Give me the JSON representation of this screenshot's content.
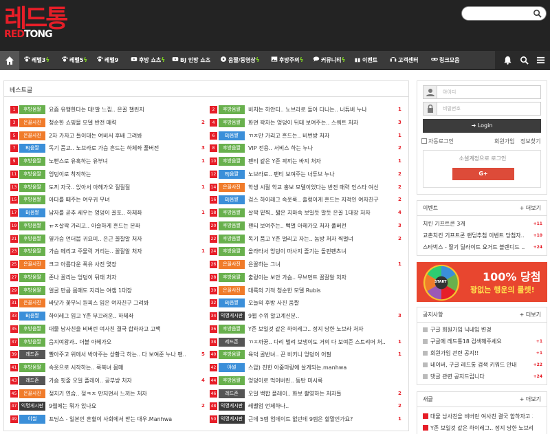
{
  "logo": {
    "ko": "레드통",
    "en_red": "RED",
    "en_white": "TONG"
  },
  "nav": {
    "items": [
      {
        "label": "레벨3",
        "icon": "paw-icon",
        "bolt": true
      },
      {
        "label": "레벨5",
        "icon": "paw-icon",
        "bolt": true
      },
      {
        "label": "레벨9",
        "icon": "paw-icon",
        "bolt": false
      },
      {
        "label": "후방 쇼츠",
        "icon": "youtube-icon",
        "bolt": true
      },
      {
        "label": "BJ 인방 쇼츠",
        "icon": "youtube-icon",
        "bolt": false
      },
      {
        "label": "움짤/동영상",
        "icon": "play-icon",
        "bolt": true
      },
      {
        "label": "후방주의",
        "icon": "image-icon",
        "bolt": true
      },
      {
        "label": "커뮤니티",
        "icon": "chat-icon",
        "bolt": true
      },
      {
        "label": "이벤트",
        "icon": "gift-icon",
        "bolt": false
      },
      {
        "label": "고객센터",
        "icon": "headset-icon",
        "bolt": false
      },
      {
        "label": "링크모음",
        "icon": "link-icon",
        "bolt": false
      }
    ]
  },
  "best": {
    "title": "베스트글",
    "badge_colors": {
      "후방움짤": "#68b04d",
      "은꼴사진": "#f07b2a",
      "BJ움짤": "#3b8fd9",
      "레드존": "#555555",
      "익명게시판": "#3a3a3a",
      "야썰": "#3b8fd9"
    },
    "left": [
      {
        "n": "1",
        "b": "후방움짤",
        "t": "요즘 유행한다는 대!발 느낌.. 은꼴 챌린지",
        "c": ""
      },
      {
        "n": "3",
        "b": "은꼴사진",
        "t": "청순한 쇼핑몰 모델 반전 매력",
        "c": "2"
      },
      {
        "n": "5",
        "b": "은꼴사진",
        "t": "2차 가자고 들이대는 여비서 후배 그려봐",
        "c": ""
      },
      {
        "n": "7",
        "b": "BJ움짤",
        "t": "독기 품고.. 노브라로 가슴 흔드는 하체좌 풀버전",
        "c": "3"
      },
      {
        "n": "9",
        "b": "후방움짤",
        "t": "노빤스로 유혹하는 유부녀",
        "c": "1"
      },
      {
        "n": "11",
        "b": "후방움짤",
        "t": "엉덩이로 착작하는",
        "c": ""
      },
      {
        "n": "13",
        "b": "후방움짤",
        "t": "도끼 자국.. 앉아서 아헤가오 질질질",
        "c": "1"
      },
      {
        "n": "15",
        "b": "후방움짤",
        "t": "아다를 떼주는 여우귀 무녀",
        "c": ""
      },
      {
        "n": "17",
        "b": "BJ움짤",
        "t": "남자를 곧추 세우는 엉덩이 꼴포.. 하체좌",
        "c": "1"
      },
      {
        "n": "19",
        "b": "후방움짤",
        "t": "ㅠㅈ살짝 가리고.. 아슬하게 흔드는 본좌",
        "c": ""
      },
      {
        "n": "21",
        "b": "후방움짤",
        "t": "옆가슴 언더붑 귀요미.. 은근 꼴잘알 처자",
        "c": ""
      },
      {
        "n": "23",
        "b": "후방움짤",
        "t": "가슴 떼리고 주물럭 거리는.. 꼴잘알 처자",
        "c": "1"
      },
      {
        "n": "25",
        "b": "은꼴사진",
        "t": "크고 아름다운 폭유 사진 몇장",
        "c": ""
      },
      {
        "n": "27",
        "b": "후방움짤",
        "t": "존나 꼴리는 엉덩이 뒤태 처자",
        "c": ""
      },
      {
        "n": "29",
        "b": "후방움짤",
        "t": "얼굴 만큼 몸매도 지리는 여캠 1대장",
        "c": ""
      },
      {
        "n": "31",
        "b": "은꼴사진",
        "t": "바닷가 꽃무늬 원피스 입은 여자친구 그려봐",
        "c": ""
      },
      {
        "n": "33",
        "b": "BJ움짤",
        "t": "하이레그 입고 Y존 부끄러운.. 하체좌",
        "c": ""
      },
      {
        "n": "35",
        "b": "후방움짤",
        "t": "대물 남사친을 비버린 여사친 결국 합하자고 고백",
        "c": ""
      },
      {
        "n": "37",
        "b": "후방움짤",
        "t": "음지여왕과.. 더블 아헤가오",
        "c": ""
      },
      {
        "n": "39",
        "b": "레드존",
        "t": "빨아주고 위에서 박아주는 상황극 하는.. 다 보여준 누나 팬..",
        "c": "5"
      },
      {
        "n": "41",
        "b": "후방움짤",
        "t": "속옷으로 시작하는.. 룩북녀 몸매",
        "c": ""
      },
      {
        "n": "43",
        "b": "레드존",
        "t": "가슴 핏줄 오일 플레이.. 공부방 처자",
        "c": "4"
      },
      {
        "n": "45",
        "b": "은꼴사진",
        "t": "젖치기 연습.. 젖ㅋㅈ 만지면서 느끼는 처자",
        "c": ""
      },
      {
        "n": "47",
        "b": "익명게시판",
        "t": "9웹에는 뭐가 있나요",
        "c": "2"
      },
      {
        "n": "49",
        "b": "야썰",
        "t": "프딩스 - 일본인 혼혈이 사회에서 받는 대우.Manhwa",
        "c": ""
      }
    ],
    "right": [
      {
        "n": "2",
        "b": "후방움짤",
        "t": "비치는 하얀티.. 노브라로 돌아 다니는.. 너튜버 누나",
        "c": "1"
      },
      {
        "n": "4",
        "b": "후방움짤",
        "t": "화면 꽉차는 엉덩이 뒤태 보여주는.. 스쿼트 처자",
        "c": "3"
      },
      {
        "n": "6",
        "b": "BJ움짤",
        "t": "ㄲㅈ만 가리고 흔드는.. 비번방 처자",
        "c": "1"
      },
      {
        "n": "8",
        "b": "후방움짤",
        "t": "VIP 전용.. 서비스 하는 누나",
        "c": "2"
      },
      {
        "n": "10",
        "b": "후방움짤",
        "t": "팬티 같은 Y존 꽉끼는 바지 처자",
        "c": "1"
      },
      {
        "n": "12",
        "b": "BJ움짤",
        "t": "노브라로.. 팬티 보여주는 너튜브 누나",
        "c": "2"
      },
      {
        "n": "14",
        "b": "은꼴사진",
        "t": "학생 시절 학교 홍보 모델이었다는 반전 매력 인스타 여신",
        "c": "2"
      },
      {
        "n": "16",
        "b": "BJ움짤",
        "t": "검스 하이레그 속옷룩.. 출렁이게 흔드는 지적인 여자친구",
        "c": "2"
      },
      {
        "n": "18",
        "b": "후방움짤",
        "t": "살짝 밑찍.. 짧은 치마속 보일듯 말듯 은꼴 1대장 처자",
        "c": "4"
      },
      {
        "n": "20",
        "b": "후방움짤",
        "t": "팬티 보여주는.. 뻑벌 아헤가오 처자 풀버전",
        "c": "3"
      },
      {
        "n": "22",
        "b": "후방움짤",
        "t": "독기 품고 Y존 벌리고 자는.. 놈방 처자 찍벌녀",
        "c": "2"
      },
      {
        "n": "24",
        "b": "후방움짤",
        "t": "올라타서 엉덩이 마사지 즐기는 돌핀팬츠녀",
        "c": ""
      },
      {
        "n": "26",
        "b": "은꼴사진",
        "t": "은꼴하는 그녀",
        "c": "1"
      },
      {
        "n": "28",
        "b": "후방움짤",
        "t": "출렁이는 보안 가슴.. 무브먼트 꼴잘알 처자",
        "c": ""
      },
      {
        "n": "30",
        "b": "은꼴사진",
        "t": "대륙의 기적 청순한 모델 Rubis",
        "c": ""
      },
      {
        "n": "32",
        "b": "BJ움짤",
        "t": "오늘의 후방 사진 움짤",
        "c": ""
      },
      {
        "n": "34",
        "b": "익명게시판",
        "t": "9웹 수위 알고계신분..",
        "c": "3"
      },
      {
        "n": "36",
        "b": "후방움짤",
        "t": "Y존 보일것 같은 하이레그.. 정지 당한 노브라 처자",
        "c": ""
      },
      {
        "n": "38",
        "b": "레드존",
        "t": "ㄲㅈ까꿍.. 다리 벌려 보댕이도 거의 다 보여준 스트리머 처..",
        "c": "1"
      },
      {
        "n": "40",
        "b": "후방움짤",
        "t": "육덕 골반녀.. 끈 비키니 엉덩이 어필",
        "c": "1"
      },
      {
        "n": "42",
        "b": "야썰",
        "t": "스압) 친한 아줌마랑에 살게되는.manhwa",
        "c": ""
      },
      {
        "n": "44",
        "b": "후방움짤",
        "t": "엉덩이로 먹어버린.. 동탄 미시룩",
        "c": ""
      },
      {
        "n": "46",
        "b": "레드존",
        "t": "오일 백합 플레이.. 화보 촬영하는 처자들",
        "c": "2"
      },
      {
        "n": "48",
        "b": "익명게시판",
        "t": "레벨업 언제하나..",
        "c": "2"
      },
      {
        "n": "50",
        "b": "익명게시판",
        "t": "근데 5렙 업데이트 없던데 9렙은 할말인가요?",
        "c": "1"
      }
    ]
  },
  "login": {
    "id_placeholder": "아이디",
    "pw_placeholder": "비밀번호",
    "button": "Login",
    "auto": "자동로그인",
    "join": "회원가입",
    "find": "정보찾기",
    "social": "소셜계정으로 로그인",
    "gplus": "G+"
  },
  "event": {
    "title": "이벤트",
    "more": "+ 더보기",
    "items": [
      {
        "t": "치킨 기프트콘 3개",
        "c": "+11"
      },
      {
        "t": "교촌치킨 기프트콘 랜덤추첨 이벤트 당첨자..",
        "c": "+10"
      },
      {
        "t": "스타벅스 - 딸기 딜라이트 요거트 블렌디드 ..",
        "c": "+24"
      }
    ]
  },
  "banner": {
    "main": "100% 당첨",
    "sub": "꽝없는 행운의 룰렛!",
    "start": "START"
  },
  "notice": {
    "title": "공지사항",
    "more": "+ 더보기",
    "items": [
      {
        "t": "구글 회원가입 닉네임 변경",
        "c": ""
      },
      {
        "t": "구글에 레드통18 검색해주세요",
        "c": "+1"
      },
      {
        "t": "회원가입 관련 공지!!",
        "c": "+1"
      },
      {
        "t": "네이버, 구글 레드통 검색 키워드 안내",
        "c": "+22"
      },
      {
        "t": "댓글 관련 공지드립니다",
        "c": "+24"
      }
    ]
  },
  "newposts": {
    "title": "새글",
    "more": "+ 더보기",
    "items": [
      {
        "t": "대물 남사친을 비버린 여사친 결국 합하자고 고백"
      },
      {
        "t": "Y존 보일것 같은 하이레그.. 정지 당한 노브라 처자"
      }
    ]
  }
}
